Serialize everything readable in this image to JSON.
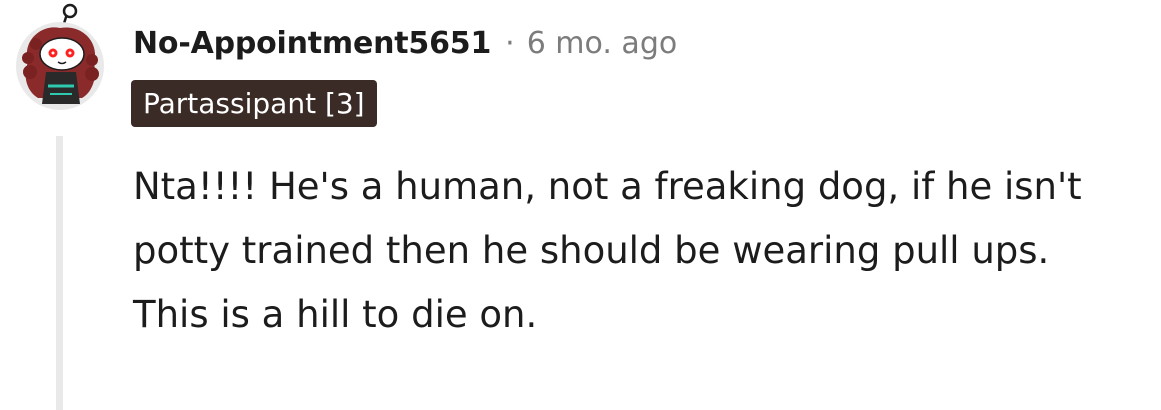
{
  "comment": {
    "author": "No-Appointment5651",
    "separator": "·",
    "timestamp": "6 mo. ago",
    "flair": "Partassipant [3]",
    "avatar_icon": "snoo-avatar-icon",
    "body": [
      "Nta!!!! He's a human, not a freaking dog, if he isn't potty trained then he should be wearing pull ups.",
      "This is a hill to die on."
    ]
  },
  "colors": {
    "author": "#1c1c1c",
    "meta": "#7c7c7c",
    "flair_bg": "#3a2b26",
    "flair_text": "#ffffff",
    "thread_line": "#e9e9e9",
    "avatar_hair": "#8b2a2a",
    "avatar_eyes": "#ff2020",
    "avatar_accent": "#2fc9b0"
  }
}
